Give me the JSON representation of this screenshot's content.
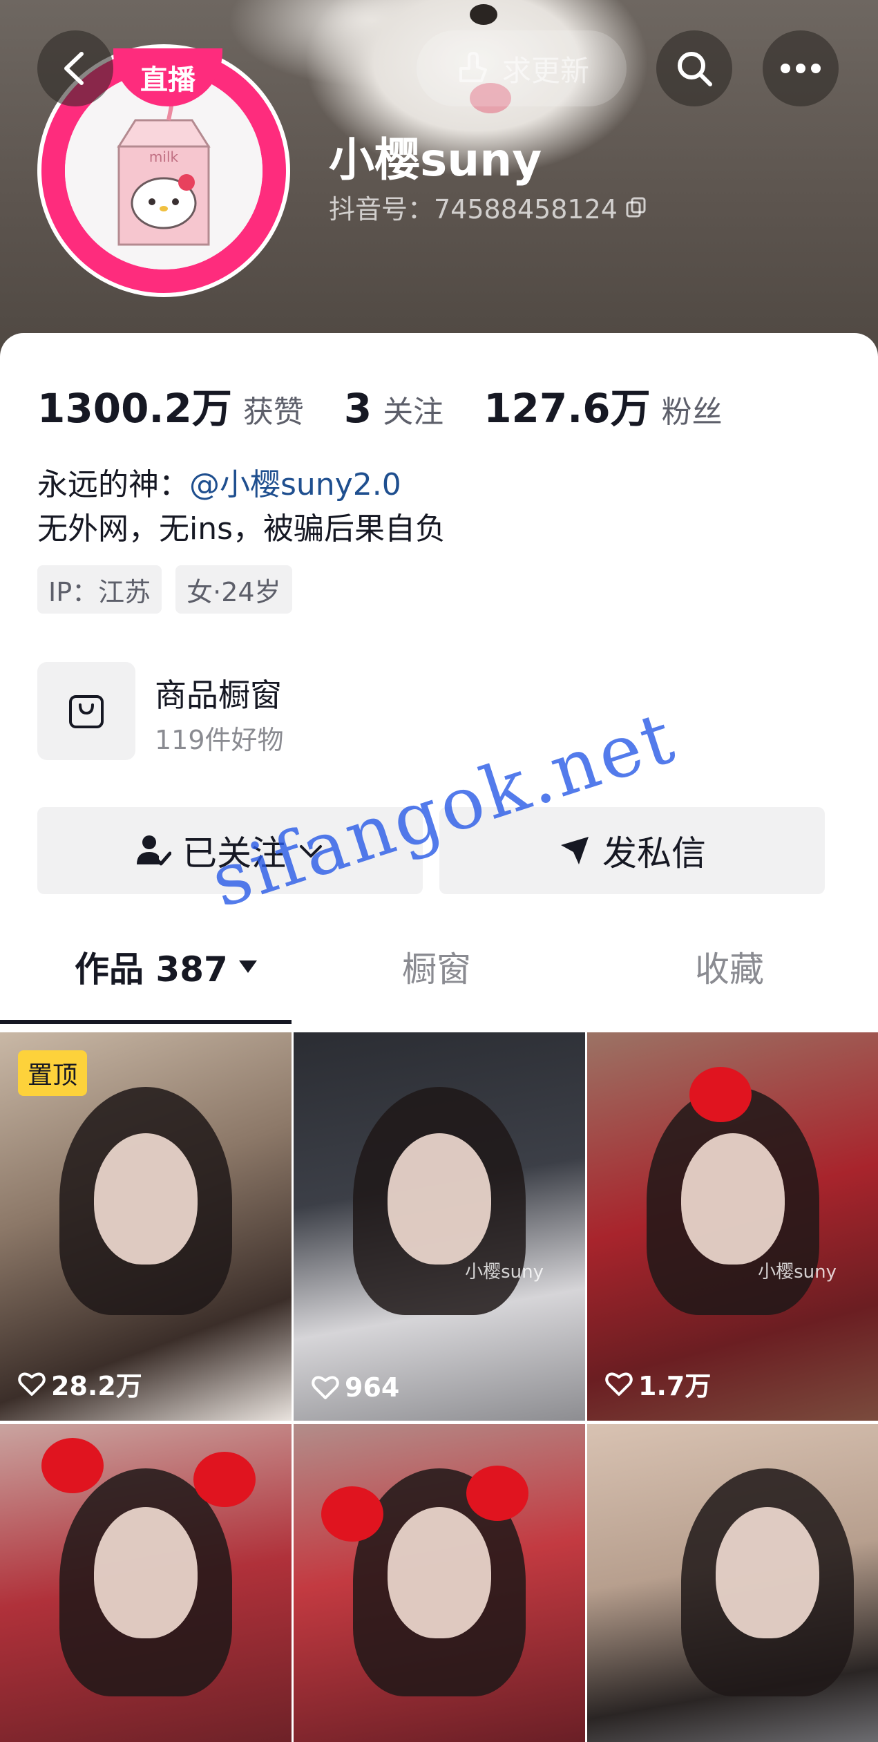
{
  "header": {
    "update_label": "求更新",
    "live_label": "直播",
    "name": "小樱suny",
    "douyin_id": "抖音号：74588458124"
  },
  "stats": [
    {
      "value": "1300.2万",
      "label": "获赞"
    },
    {
      "value": "3",
      "label": "关注"
    },
    {
      "value": "127.6万",
      "label": "粉丝"
    }
  ],
  "bio": {
    "line1_prefix": "永远的神：",
    "mention": "@小樱suny2.0",
    "line2": "无外网，无ins，被骗后果自负"
  },
  "tags": [
    "IP：江苏",
    "女·24岁"
  ],
  "shop": {
    "title": "商品橱窗",
    "subtitle": "119件好物"
  },
  "actions": {
    "follow_label": "已关注",
    "message_label": "发私信"
  },
  "tabs": [
    {
      "label": "作品 387"
    },
    {
      "label": "橱窗"
    },
    {
      "label": "收藏"
    }
  ],
  "videos": [
    {
      "likes": "28.2万",
      "pinned": "置顶",
      "caption": ""
    },
    {
      "likes": "964",
      "pinned": "",
      "caption": "小樱suny"
    },
    {
      "likes": "1.7万",
      "pinned": "",
      "caption": "小樱suny"
    },
    {
      "likes": "",
      "pinned": "",
      "caption": ""
    },
    {
      "likes": "",
      "pinned": "",
      "caption": ""
    },
    {
      "likes": "",
      "pinned": "",
      "caption": ""
    }
  ],
  "watermark": "sifangok.net",
  "colors": {
    "live_pink": "#fe2c7d",
    "mention_blue": "#1f4f8f",
    "pin_yellow": "#fdd23b"
  }
}
